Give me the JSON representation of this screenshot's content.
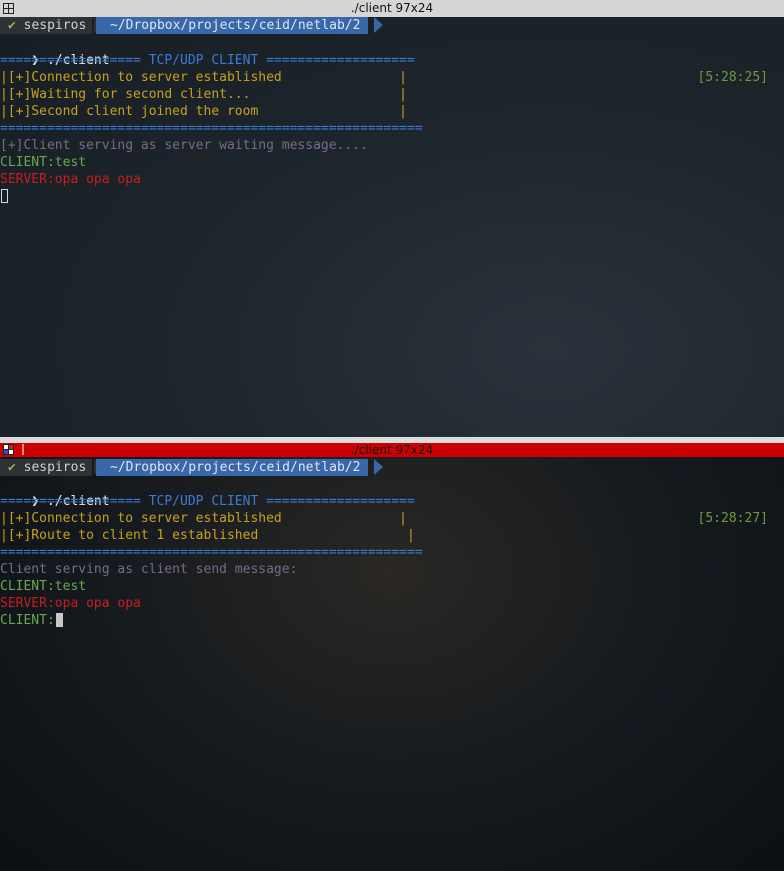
{
  "top": {
    "title": "./client 97x24",
    "prompt": {
      "check": "✔",
      "user": "sespiros",
      "path": "~/Dropbox/projects/ceid/netlab/2"
    },
    "command_prefix": "❯",
    "command": "./client",
    "time": "[5:28:25]",
    "header": "================== TCP/UDP CLIENT ===================",
    "box_lines": [
      "|[+]Connection to server established               |",
      "|[+]Waiting for second client...                   |",
      "|[+]Second client joined the room                  |"
    ],
    "footer": "======================================================",
    "status": "[+]Client serving as server waiting message....",
    "client_line": "CLIENT:test",
    "server_line": "SERVER:opa opa opa"
  },
  "bottom": {
    "title": "./client 97x24",
    "prompt": {
      "check": "✔",
      "user": "sespiros",
      "path": "~/Dropbox/projects/ceid/netlab/2"
    },
    "command_prefix": "❯",
    "command": "./client",
    "time": "[5:28:27]",
    "header": "================== TCP/UDP CLIENT ===================",
    "box_lines": [
      "|[+]Connection to server established               |",
      "|[+]Route to client 1 established                   |"
    ],
    "footer": "======================================================",
    "status": "Client serving as client send message:",
    "client_line": "CLIENT:test",
    "server_line": "SERVER:opa opa opa",
    "input_prompt": "CLIENT:"
  },
  "colors": {
    "titlebar_active": "#cc0000",
    "prompt_path_bg": "#3968a8",
    "header": "#3a7bd5",
    "box_text": "#c8a020",
    "client": "#6aa84f",
    "server": "#c81e1e"
  }
}
